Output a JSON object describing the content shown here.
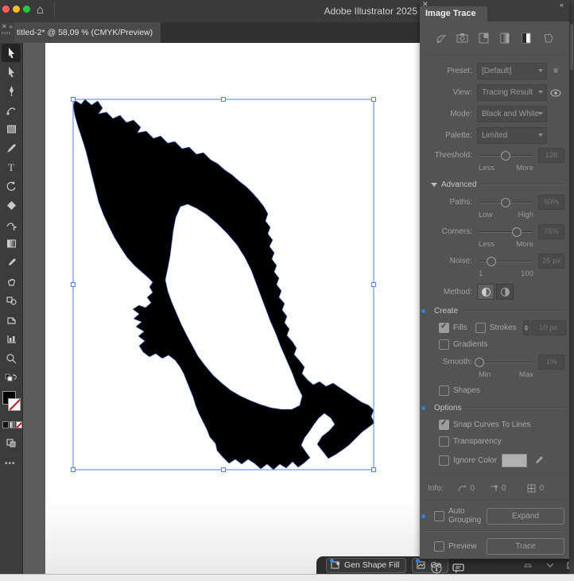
{
  "icons": {
    "home": "⌂",
    "panel_close": "✕",
    "tools_close": "✕",
    "tools_collapse": "»",
    "dock_collapse": "«",
    "preset_menu": "≡",
    "more_dots": "•••"
  },
  "titlebar": {
    "app_title": "Adobe Illustrator 2025"
  },
  "document_tab": {
    "label": "titled-2* @ 58,09 % (CMYK/Preview)"
  },
  "panel": {
    "title": "Image Trace",
    "preset": {
      "label": "Preset:",
      "value": "[Default]"
    },
    "view": {
      "label": "View:",
      "value": "Tracing Result"
    },
    "mode": {
      "label": "Mode:",
      "value": "Black and White"
    },
    "palette": {
      "label": "Palette:",
      "value": "Limited"
    },
    "threshold": {
      "label": "Threshold:",
      "value": "128",
      "min_label": "Less",
      "max_label": "More",
      "percent": 50
    },
    "advanced": {
      "label": "Advanced"
    },
    "paths": {
      "label": "Paths:",
      "value": "50%",
      "min_label": "Low",
      "max_label": "High",
      "percent": 50
    },
    "corners": {
      "label": "Corners:",
      "value": "75%",
      "min_label": "Less",
      "max_label": "More",
      "percent": 72
    },
    "noise": {
      "label": "Noise:",
      "value": "25 px",
      "min_label": "1",
      "max_label": "100",
      "percent": 24
    },
    "method": {
      "label": "Method:"
    },
    "create": {
      "label": "Create",
      "fills_label": "Fills",
      "strokes_label": "Strokes",
      "strokes_value": "10 px",
      "gradients_label": "Gradients",
      "smooth": {
        "label": "Smooth:",
        "value": "1%",
        "min_label": "Min",
        "max_label": "Max",
        "percent": 2
      },
      "shapes_label": "Shapes"
    },
    "options": {
      "label": "Options",
      "snap_label": "Snap Curves To Lines",
      "transparency_label": "Transparency",
      "ignore_color_label": "Ignore Color"
    },
    "info": {
      "label": "Info:",
      "paths_count": "0",
      "anchors_count": "0",
      "colors_count": "0"
    },
    "auto_grouping": {
      "label": "Auto Grouping",
      "expand_label": "Expand"
    },
    "preview": {
      "label": "Preview",
      "trace_label": "Trace"
    },
    "states": {
      "fills": true,
      "strokes": false,
      "gradients": false,
      "shapes": false,
      "snap_curves": true,
      "transparency": false,
      "ignore_color": false,
      "auto_grouping": false,
      "preview": false
    }
  },
  "taskbar": {
    "buttons": [
      {
        "label": "Gen Shape Fill"
      },
      {
        "label": "Ge"
      }
    ]
  },
  "selection": {
    "zoom_percent": "58,09 %",
    "color": "#4f80ff"
  }
}
